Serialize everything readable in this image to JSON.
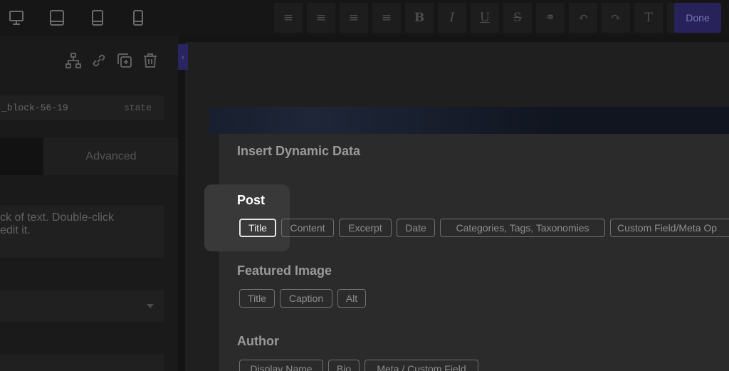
{
  "toolbar": {
    "device_icons": [
      "desktop-icon",
      "tablet-landscape-icon",
      "tablet-portrait-icon",
      "phone-icon"
    ],
    "format_buttons": [
      {
        "name": "align-left-button",
        "glyph": "≡"
      },
      {
        "name": "align-center-button",
        "glyph": "≡"
      },
      {
        "name": "align-right-button",
        "glyph": "≡"
      },
      {
        "name": "align-justify-button",
        "glyph": "≡"
      },
      {
        "name": "bold-button",
        "glyph": "B"
      },
      {
        "name": "italic-button",
        "glyph": "I"
      },
      {
        "name": "underline-button",
        "glyph": "U"
      },
      {
        "name": "strikethrough-button",
        "glyph": "S"
      },
      {
        "name": "link-button",
        "glyph": "⚭"
      },
      {
        "name": "undo-button",
        "glyph": "↶"
      },
      {
        "name": "redo-button",
        "glyph": "↷"
      },
      {
        "name": "clear-format-button",
        "glyph": "T"
      },
      {
        "name": "more-button",
        "glyph": "⋯"
      }
    ],
    "done_label": "Done"
  },
  "left_panel": {
    "action_icons": [
      "structure-icon",
      "link-icon",
      "duplicate-icon",
      "trash-icon"
    ],
    "selector_id": "_block-56-19",
    "selector_state": "state",
    "tab_advanced": "Advanced",
    "text_preview": "ck of text. Double-click\nedit it."
  },
  "modal": {
    "title": "Insert Dynamic Data",
    "sections": [
      {
        "title": "Post",
        "chips": [
          "Title",
          "Content",
          "Excerpt",
          "Date",
          "Categories, Tags, Taxonomies",
          "Custom Field/Meta Op"
        ]
      },
      {
        "title": "Featured Image",
        "chips": [
          "Title",
          "Caption",
          "Alt"
        ]
      },
      {
        "title": "Author",
        "chips": [
          "Display Name",
          "Bio",
          "Meta / Custom Field"
        ]
      }
    ]
  }
}
